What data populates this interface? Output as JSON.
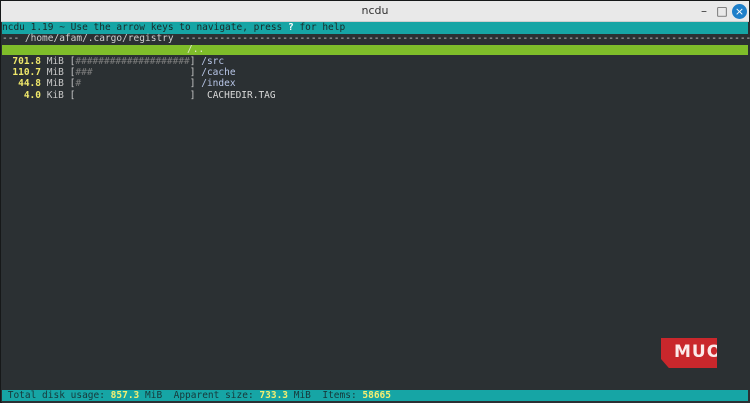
{
  "window": {
    "title": "ncdu",
    "controls": {
      "minimize": "–",
      "maximize": "□",
      "close": "×"
    }
  },
  "header": {
    "text_before_key": "ncdu 1.19 ~ Use the arrow keys to navigate, press ",
    "help_key": "?",
    "text_after_key": " for help"
  },
  "path_line": {
    "prefix": "--- ",
    "path": "/home/afam/.cargo/registry",
    "suffix": " --------------------------------------------------------------------------------------------------------"
  },
  "selected_row": {
    "name": "/.."
  },
  "rows": [
    {
      "size": "701.8",
      "unit": "MiB",
      "open": "[",
      "bar": "####################",
      "close": "]",
      "name": "/src",
      "kind": "dir",
      "fill": 0.8178
    },
    {
      "size": "110.7",
      "unit": "MiB",
      "open": "[",
      "bar": "###                 ",
      "close": "]",
      "name": "/cache",
      "kind": "dir",
      "fill": 0.129
    },
    {
      "size": "44.8",
      "unit": "MiB",
      "open": "[",
      "bar": "#                   ",
      "close": "]",
      "name": "/index",
      "kind": "dir",
      "fill": 0.052
    },
    {
      "size": "4.0",
      "unit": "KiB",
      "open": "[",
      "bar": "                    ",
      "close": "]",
      "name": "CACHEDIR.TAG",
      "kind": "file",
      "fill": 0.0
    }
  ],
  "footer": {
    "disk_label": " Total disk usage: ",
    "disk_value": "857.3",
    "disk_unit": " MiB  ",
    "apparent_label": "Apparent size: ",
    "apparent_value": "733.3",
    "apparent_unit": " MiB  ",
    "items_label": "Items: ",
    "items_value": "58665"
  },
  "watermark": {
    "text": "MUO",
    "color": "#c9272c"
  }
}
